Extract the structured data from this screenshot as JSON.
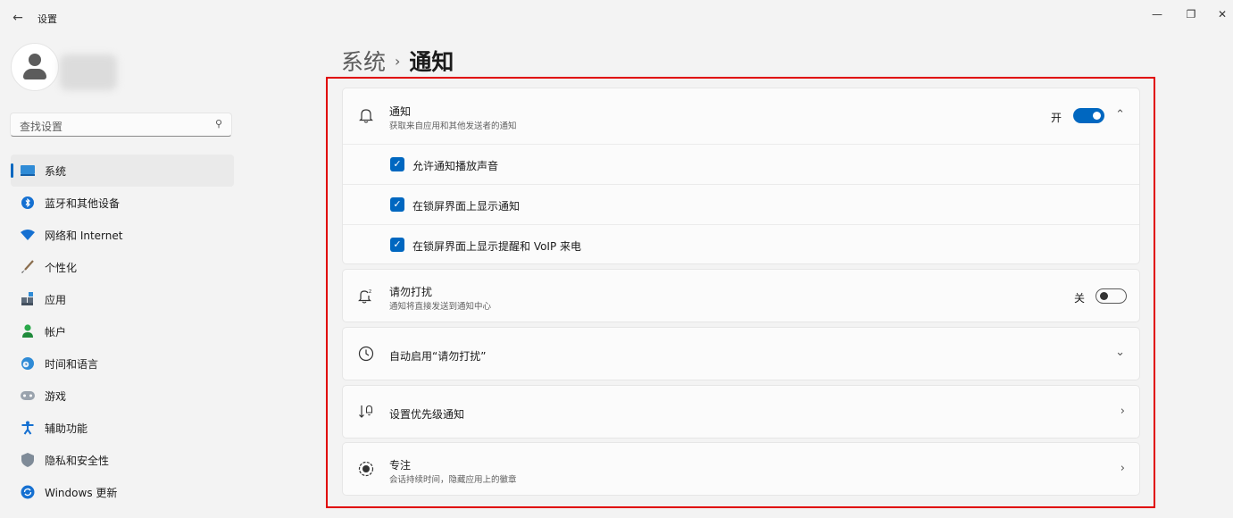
{
  "window": {
    "title": "设置",
    "back_icon": "←",
    "minimize_icon": "—",
    "maximize_icon": "❐",
    "close_icon": "✕"
  },
  "search": {
    "placeholder": "查找设置",
    "icon": "⚲"
  },
  "sidebar": {
    "items": [
      {
        "label": "系统",
        "icon": "system-icon",
        "active": true
      },
      {
        "label": "蓝牙和其他设备",
        "icon": "bluetooth-icon"
      },
      {
        "label": "网络和 Internet",
        "icon": "wifi-icon"
      },
      {
        "label": "个性化",
        "icon": "brush-icon"
      },
      {
        "label": "应用",
        "icon": "apps-icon"
      },
      {
        "label": "帐户",
        "icon": "account-icon"
      },
      {
        "label": "时间和语言",
        "icon": "globe-icon"
      },
      {
        "label": "游戏",
        "icon": "gamepad-icon"
      },
      {
        "label": "辅助功能",
        "icon": "accessibility-icon"
      },
      {
        "label": "隐私和安全性",
        "icon": "shield-icon"
      },
      {
        "label": "Windows 更新",
        "icon": "update-icon"
      }
    ]
  },
  "breadcrumb": {
    "parent": "系统",
    "separator": "›",
    "current": "通知"
  },
  "notifications": {
    "title": "通知",
    "subtitle": "获取来自应用和其他发送者的通知",
    "toggle_text": "开",
    "toggle_on": true,
    "expand_icon": "⌃",
    "options": [
      {
        "label": "允许通知播放声音",
        "checked": true
      },
      {
        "label": "在锁屏界面上显示通知",
        "checked": true
      },
      {
        "label": "在锁屏界面上显示提醒和 VoIP 来电",
        "checked": true
      }
    ]
  },
  "dnd": {
    "title": "请勿打扰",
    "subtitle": "通知将直接发送到通知中心",
    "toggle_text": "关",
    "toggle_on": false
  },
  "auto_dnd": {
    "title": "自动启用“请勿打扰”",
    "chevron": "⌄"
  },
  "priority": {
    "title": "设置优先级通知",
    "chevron": "›"
  },
  "focus": {
    "title": "专注",
    "subtitle": "会话持续时间，隐藏应用上的徽章",
    "chevron": "›"
  },
  "colors": {
    "accent": "#0067c0",
    "highlight_border": "#e00000"
  }
}
